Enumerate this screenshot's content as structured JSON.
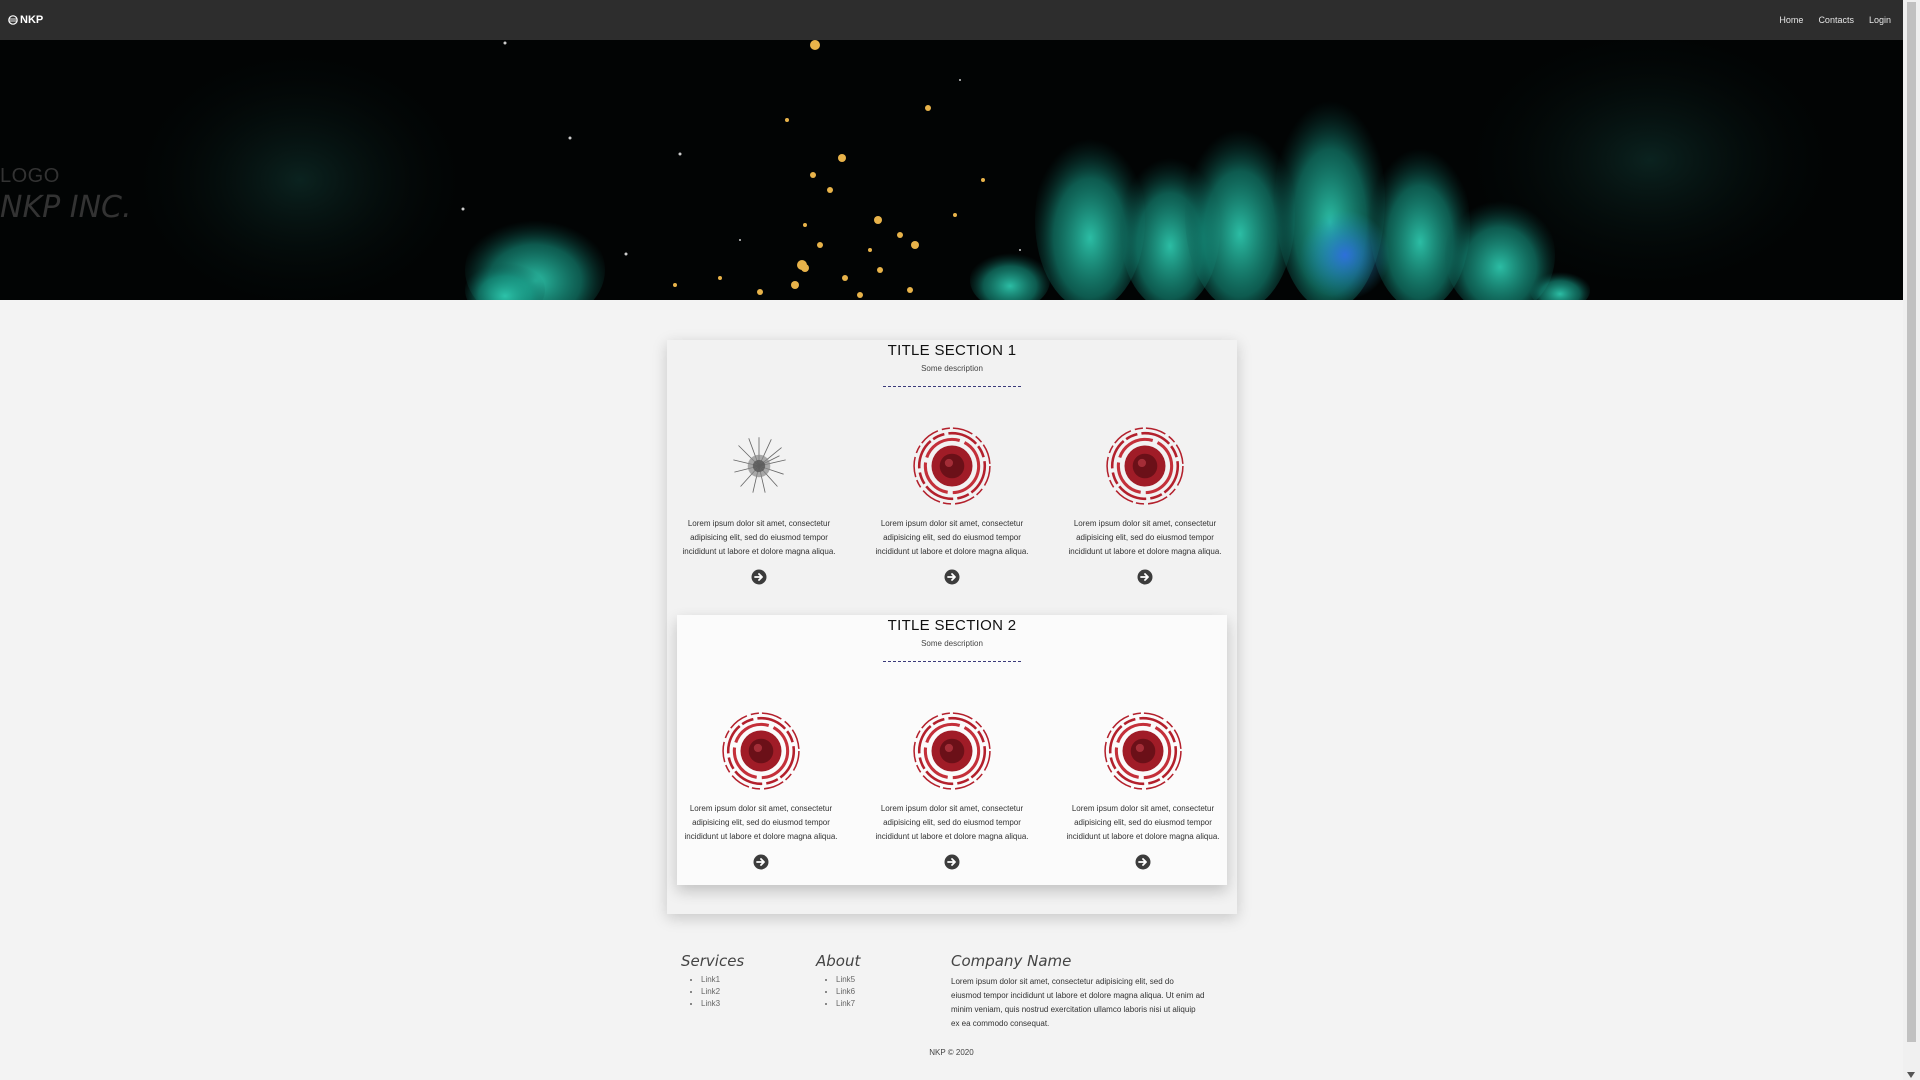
{
  "nav": {
    "brand": "NKP",
    "links": [
      "Home",
      "Contacts",
      "Login"
    ]
  },
  "hero": {
    "logo": "LOGO",
    "company": "NKP INC."
  },
  "sections": [
    {
      "title": "TITLE SECTION 1",
      "description": "Some description",
      "items": [
        {
          "image": "splash-image",
          "text": "Lorem ipsum dolor sit amet, consectetur adipisicing elit, sed do eiusmod tempor incididunt ut labore et dolore magna aliqua."
        },
        {
          "image": "red-target-image",
          "text": "Lorem ipsum dolor sit amet, consectetur adipisicing elit, sed do eiusmod tempor incididunt ut labore et dolore magna aliqua."
        },
        {
          "image": "red-target-image",
          "text": "Lorem ipsum dolor sit amet, consectetur adipisicing elit, sed do eiusmod tempor incididunt ut labore et dolore magna aliqua."
        }
      ]
    },
    {
      "title": "TITLE SECTION 2",
      "description": "Some description",
      "items": [
        {
          "image": "red-target-image",
          "text": "Lorem ipsum dolor sit amet, consectetur adipisicing elit, sed do eiusmod tempor incididunt ut labore et dolore magna aliqua."
        },
        {
          "image": "red-target-image",
          "text": "Lorem ipsum dolor sit amet, consectetur adipisicing elit, sed do eiusmod tempor incididunt ut labore et dolore magna aliqua."
        },
        {
          "image": "red-target-image",
          "text": "Lorem ipsum dolor sit amet, consectetur adipisicing elit, sed do eiusmod tempor incididunt ut labore et dolore magna aliqua."
        }
      ]
    }
  ],
  "footer": {
    "services": {
      "title": "Services",
      "links": [
        "Link1",
        "Link2",
        "Link3"
      ]
    },
    "about": {
      "title": "About",
      "links": [
        "Link5",
        "Link6",
        "Link7"
      ]
    },
    "company": {
      "title": "Company Name",
      "text": "Lorem ipsum dolor sit amet, consectetur adipisicing elit, sed do eiusmod tempor incididunt ut labore et dolore magna aliqua. Ut enim ad minim veniam, quis nostrud exercitation ullamco laboris nisi ut aliquip ex ea commodo consequat."
    },
    "copyright": "NKP © 2020"
  },
  "colors": {
    "nav_bg": "#2d2d2d",
    "accent_red": "#b3202c",
    "hero_teal": "#1fb39a",
    "hero_gold": "#e8b34a"
  }
}
